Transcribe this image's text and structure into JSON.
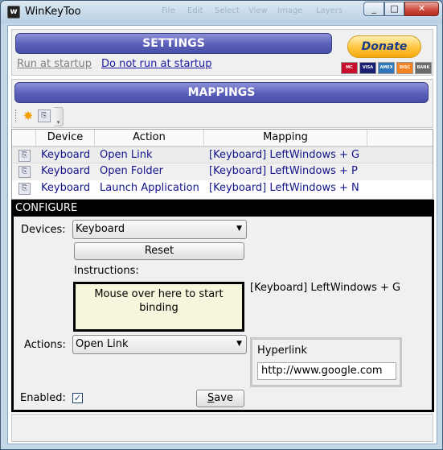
{
  "window": {
    "title": "WinKeyToo",
    "app_icon_letter": "w",
    "ghost_menu": [
      "File",
      "Edit",
      "Select",
      "View",
      "Image",
      "Layers"
    ],
    "minimize_glyph": "_",
    "maximize_glyph": "□",
    "close_glyph": "✕"
  },
  "settings": {
    "header": "SETTINGS",
    "run_at_startup": "Run at startup",
    "do_not_run_at_startup": "Do not run at startup",
    "donate_label": "Donate",
    "cards": [
      {
        "name": "mastercard",
        "label": "MC",
        "color": "#c8102e"
      },
      {
        "name": "visa",
        "label": "VISA",
        "color": "#1a1f71"
      },
      {
        "name": "amex",
        "label": "AMEX",
        "color": "#2e77bb"
      },
      {
        "name": "discover",
        "label": "DISC",
        "color": "#f58220"
      },
      {
        "name": "bank",
        "label": "BANK",
        "color": "#6b6b6b"
      }
    ]
  },
  "mappings": {
    "header": "MAPPINGS",
    "toolbar": {
      "add_icon": "sparkle-add-icon",
      "remove_icon": "remove-mapping-icon"
    },
    "columns": [
      "Device",
      "Action",
      "Mapping"
    ],
    "rows": [
      {
        "device": "Keyboard",
        "action": "Open Link",
        "mapping": "[Keyboard] LeftWindows + G"
      },
      {
        "device": "Keyboard",
        "action": "Open Folder",
        "mapping": "[Keyboard] LeftWindows + P"
      },
      {
        "device": "Keyboard",
        "action": "Launch Application",
        "mapping": "[Keyboard] LeftWindows + N"
      }
    ]
  },
  "configure": {
    "title": "CONFIGURE",
    "devices_label": "Devices:",
    "devices_value": "Keyboard",
    "reset_label": "Reset",
    "instructions_label": "Instructions:",
    "binding_prompt": "Mouse over here to start binding",
    "current_binding": "[Keyboard] LeftWindows + G",
    "actions_label": "Actions:",
    "actions_value": "Open Link",
    "hyperlink_label": "Hyperlink",
    "hyperlink_value": "http://www.google.com",
    "enabled_label": "Enabled:",
    "enabled_checked": true,
    "save_label": "Save"
  }
}
